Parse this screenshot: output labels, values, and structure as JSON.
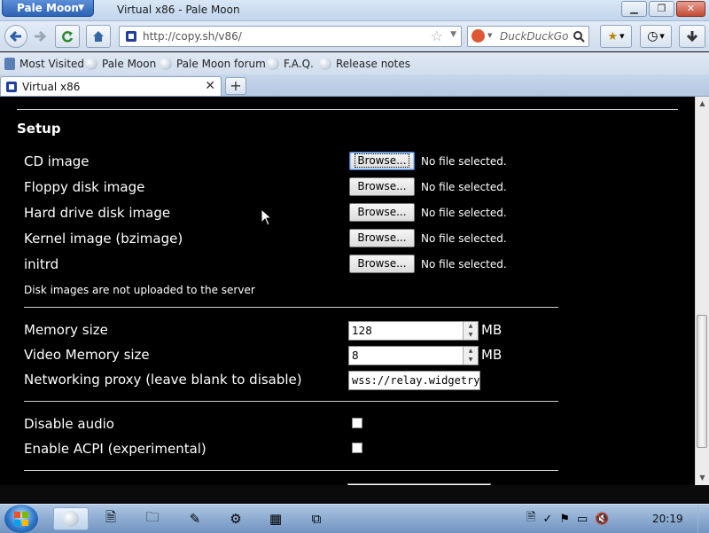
{
  "window": {
    "app_menu_label": "Pale Moon",
    "title": "Virtual x86 - Pale Moon"
  },
  "navbar": {
    "url": "http://copy.sh/v86/",
    "search_placeholder": "DuckDuckGo"
  },
  "bookmarks": [
    "Most Visited",
    "Pale Moon",
    "Pale Moon forum",
    "F.A.Q.",
    "Release notes"
  ],
  "tab": {
    "title": "Virtual x86",
    "new_tab_label": "+"
  },
  "setup": {
    "heading": "Setup",
    "browse_label": "Browse...",
    "no_file_label": "No file selected.",
    "files": [
      {
        "label": "CD image"
      },
      {
        "label": "Floppy disk image"
      },
      {
        "label": "Hard drive disk image"
      },
      {
        "label": "Kernel image (bzimage)"
      },
      {
        "label": "initrd"
      }
    ],
    "note": "Disk images are not uploaded to the server",
    "memory": {
      "label": "Memory size",
      "value": "128",
      "unit": "MB"
    },
    "video_memory": {
      "label": "Video Memory size",
      "value": "8",
      "unit": "MB"
    },
    "proxy": {
      "label": "Networking proxy (leave blank to disable)",
      "value": "wss://relay.widgetry.org/"
    },
    "disable_audio": {
      "label": "Disable audio",
      "checked": false
    },
    "enable_acpi": {
      "label": "Enable ACPI (experimental)",
      "checked": false
    }
  },
  "taskbar": {
    "clock": "20:19"
  }
}
